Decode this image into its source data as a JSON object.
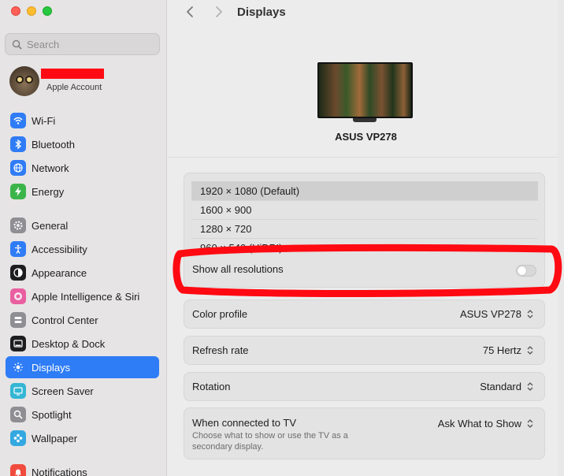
{
  "sidebar": {
    "search_placeholder": "Search",
    "account_label": "Apple Account",
    "items": [
      {
        "label": "Wi-Fi",
        "icon": "wifi-icon",
        "color": "#2f7cf6"
      },
      {
        "label": "Bluetooth",
        "icon": "bluetooth-icon",
        "color": "#2f7cf6"
      },
      {
        "label": "Network",
        "icon": "globe-icon",
        "color": "#2f7cf6"
      },
      {
        "label": "Energy",
        "icon": "bolt-icon",
        "color": "#3bb54a"
      },
      {
        "label": "General",
        "icon": "gear-icon",
        "color": "#8e8e93"
      },
      {
        "label": "Accessibility",
        "icon": "accessibility-icon",
        "color": "#2f7cf6"
      },
      {
        "label": "Appearance",
        "icon": "appearance-icon",
        "color": "#1d1d1f"
      },
      {
        "label": "Apple Intelligence & Siri",
        "icon": "siri-icon",
        "color": "#e95fa0"
      },
      {
        "label": "Control Center",
        "icon": "control-center-icon",
        "color": "#8e8e93"
      },
      {
        "label": "Desktop & Dock",
        "icon": "dock-icon",
        "color": "#1d1d1f"
      },
      {
        "label": "Displays",
        "icon": "sun-icon",
        "color": "#2f7cf6"
      },
      {
        "label": "Screen Saver",
        "icon": "screen-saver-icon",
        "color": "#34b6d4"
      },
      {
        "label": "Spotlight",
        "icon": "magnifier-icon",
        "color": "#8e8e93"
      },
      {
        "label": "Wallpaper",
        "icon": "flower-icon",
        "color": "#34a8e0"
      },
      {
        "label": "Notifications",
        "icon": "bell-icon",
        "color": "#f04b3e"
      }
    ]
  },
  "main": {
    "title": "Displays",
    "monitor_name": "ASUS VP278",
    "resolutions": [
      "1920 × 1080 (Default)",
      "1600 × 900",
      "1280 × 720",
      "960 × 540 (HiDPI)"
    ],
    "show_all_label": "Show all resolutions",
    "show_all_enabled": false,
    "color_profile": {
      "label": "Color profile",
      "value": "ASUS VP278"
    },
    "refresh_rate": {
      "label": "Refresh rate",
      "value": "75 Hertz"
    },
    "rotation": {
      "label": "Rotation",
      "value": "Standard"
    },
    "tv": {
      "label": "When connected to TV",
      "description": "Choose what to show or use the TV as a secondary display.",
      "value": "Ask What to Show"
    }
  },
  "colors": {
    "accent": "#2e7cf6",
    "annotation": "#ff0a12"
  }
}
